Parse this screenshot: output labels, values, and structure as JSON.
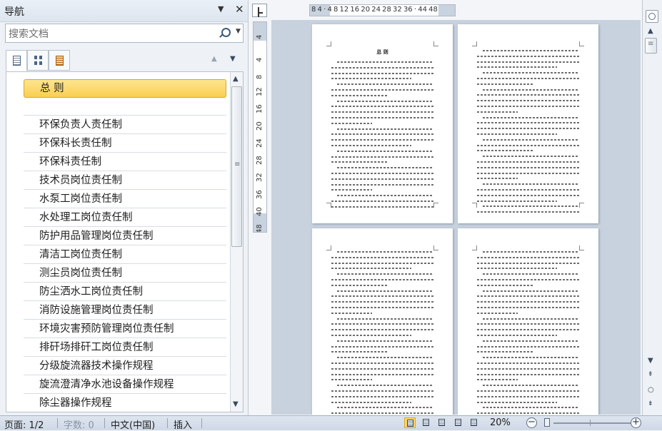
{
  "nav": {
    "title": "导航",
    "menu_glyph": "▼",
    "close_glyph": "✕",
    "search_placeholder": "搜索文档",
    "tabs": [
      "headings-tab",
      "pages-tab",
      "results-tab"
    ],
    "items": [
      {
        "label": "总 则",
        "selected": true
      },
      {
        "label": ""
      },
      {
        "label": "环保负责人责任制"
      },
      {
        "label": "环保科长责任制"
      },
      {
        "label": "环保科责任制"
      },
      {
        "label": "技术员岗位责任制"
      },
      {
        "label": "水泵工岗位责任制"
      },
      {
        "label": "水处理工岗位责任制"
      },
      {
        "label": "防护用品管理岗位责任制"
      },
      {
        "label": "清洁工岗位责任制"
      },
      {
        "label": "测尘员岗位责任制"
      },
      {
        "label": "防尘洒水工岗位责任制"
      },
      {
        "label": "消防设施管理岗位责任制"
      },
      {
        "label": "环境灾害预防管理岗位责任制"
      },
      {
        "label": "排矸场排矸工岗位责任制"
      },
      {
        "label": "分级旋流器技术操作规程"
      },
      {
        "label": "旋流澄清净水池设备操作规程"
      },
      {
        "label": "除尘器操作规程"
      }
    ]
  },
  "ruler": {
    "h_ticks": "8  4  ·  4  8 12 16 20 24 28 32 36  ·  44 48",
    "v_ticks": [
      "4",
      "4",
      "8",
      "12",
      "16",
      "20",
      "24",
      "28",
      "32",
      "36",
      "40",
      "48"
    ]
  },
  "document": {
    "page1_title": "总 则"
  },
  "status": {
    "page": "页面: 1/2",
    "words": "字数: 0",
    "language": "中文(中国)",
    "mode": "插入",
    "zoom": "20%",
    "zoom_level_percent": 20
  }
}
